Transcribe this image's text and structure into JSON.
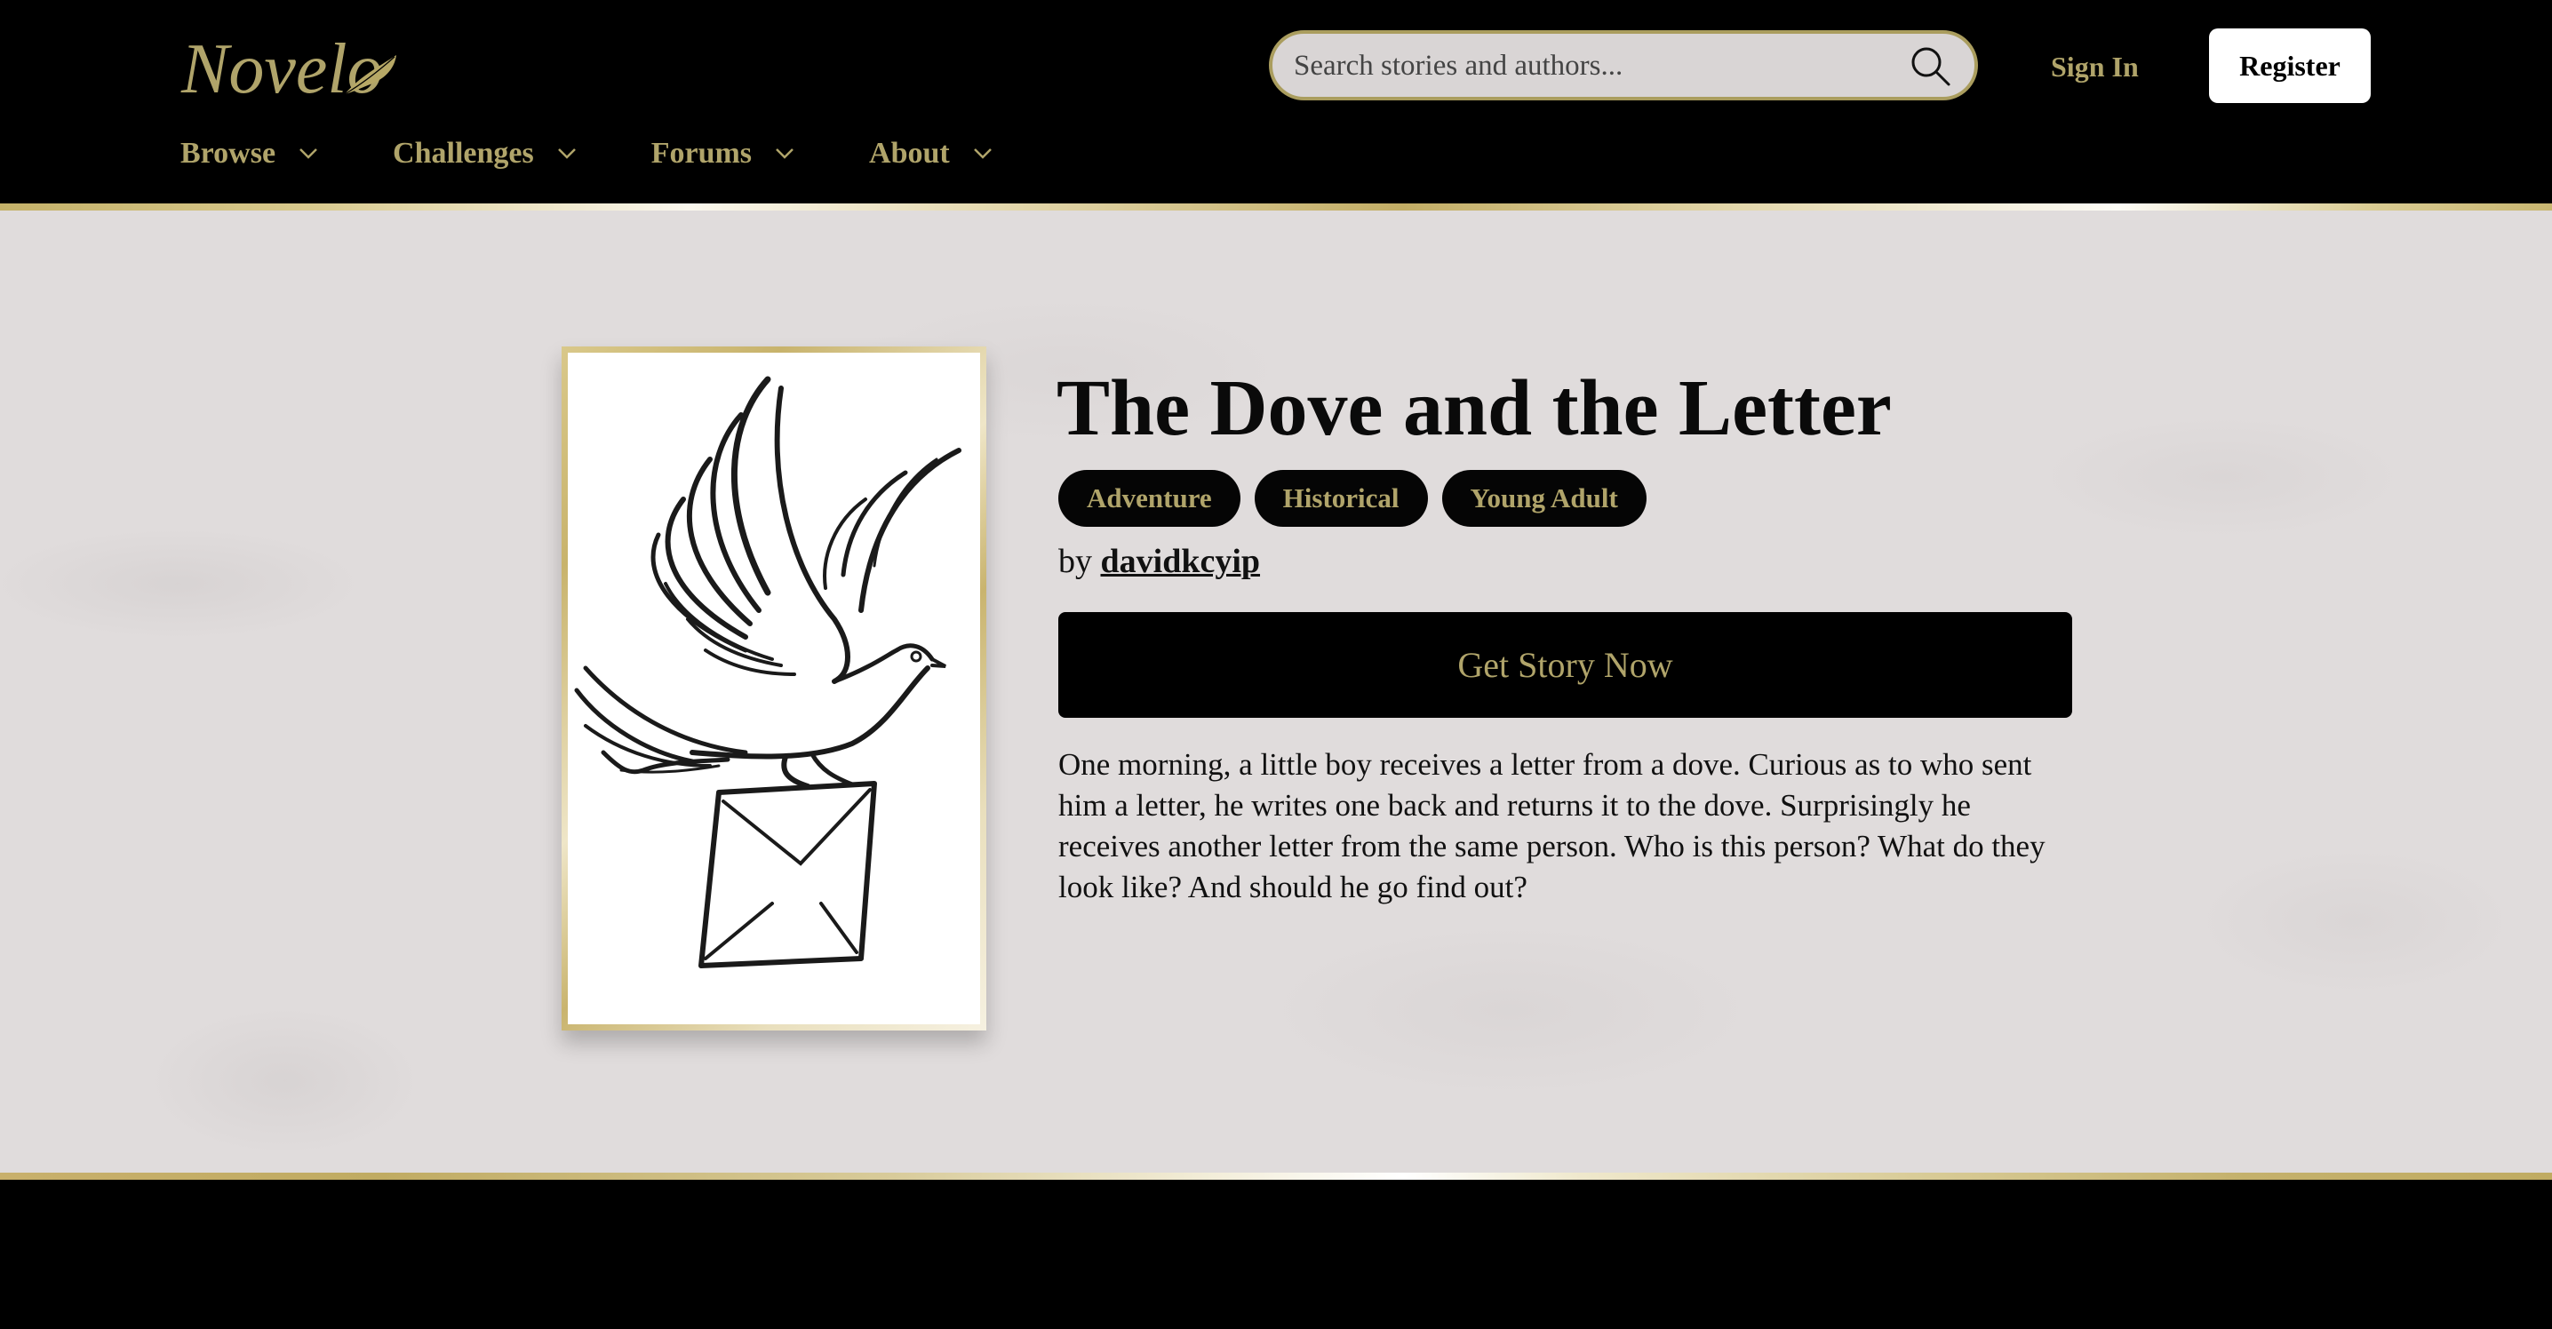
{
  "brand": {
    "name": "Novelo"
  },
  "header": {
    "search": {
      "placeholder": "Search stories and authors...",
      "value": "",
      "icon": "search-icon"
    },
    "sign_in_label": "Sign In",
    "register_label": "Register"
  },
  "nav": {
    "items": [
      {
        "label": "Browse",
        "icon": "chevron-down-icon"
      },
      {
        "label": "Challenges",
        "icon": "chevron-down-icon"
      },
      {
        "label": "Forums",
        "icon": "chevron-down-icon"
      },
      {
        "label": "About",
        "icon": "chevron-down-icon"
      }
    ]
  },
  "story": {
    "title": "The Dove and the Letter",
    "tags": [
      "Adventure",
      "Historical",
      "Young Adult"
    ],
    "by_prefix": "by",
    "author": "davidkcyip",
    "cta_label": "Get Story Now",
    "description": "One morning, a little boy receives a letter from a dove. Curious as to who sent him a letter, he writes one back and returns it to the dove. Surprisingly he receives another letter from the same person. Who is this person? What do they look like? And should he go find out?",
    "cover": {
      "alt": "Line drawing of a dove carrying an envelope"
    }
  },
  "colors": {
    "gold": "#b0a46a",
    "header_bg": "#000000",
    "hero_bg": "#e0dcdc",
    "search_fill": "#d9d5d5",
    "search_border": "#aa9d5e"
  }
}
